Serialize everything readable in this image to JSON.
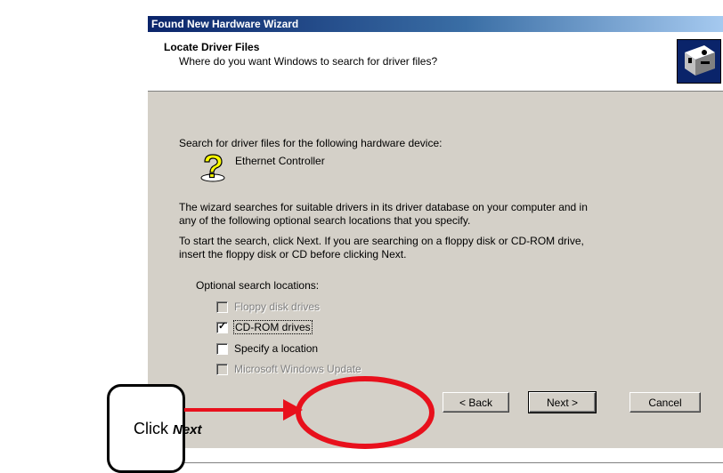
{
  "window": {
    "title": "Found New Hardware Wizard"
  },
  "header": {
    "title": "Locate Driver Files",
    "subtitle": "Where do you want Windows to search for driver files?",
    "icon": "hardware-wizard-icon"
  },
  "content": {
    "intro": "Search for driver files for the following hardware device:",
    "device_icon": "question-mark-icon",
    "device_name": "Ethernet Controller",
    "description_line1": "The wizard searches for suitable drivers in its driver database on your computer and in",
    "description_line2": "any of the following optional search locations that you specify.",
    "instruction_line1": "To start the search, click Next. If you are searching on a floppy disk or CD-ROM drive,",
    "instruction_line2": "insert the floppy disk or CD before clicking Next.",
    "locations_label": "Optional search locations:",
    "options": [
      {
        "label": "Floppy disk drives",
        "checked": false,
        "enabled": false
      },
      {
        "label": "CD-ROM drives",
        "checked": true,
        "enabled": true
      },
      {
        "label": "Specify a location",
        "checked": false,
        "enabled": true
      },
      {
        "label": "Microsoft Windows Update",
        "checked": false,
        "enabled": false
      }
    ]
  },
  "buttons": {
    "back": "< Back",
    "next": "Next >",
    "cancel": "Cancel"
  },
  "annotation": {
    "prefix": "Click ",
    "emphasis": "Next",
    "accent_color": "#e8101c"
  }
}
